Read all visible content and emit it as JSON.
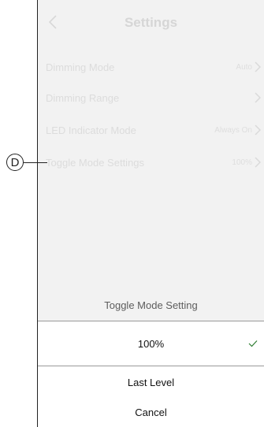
{
  "header": {
    "title": "Settings"
  },
  "settings_rows": [
    {
      "label": "Dimming Mode",
      "value": "Auto"
    },
    {
      "label": "Dimming Range",
      "value": ""
    },
    {
      "label": "LED Indicator Mode",
      "value": "Always On"
    },
    {
      "label": "Toggle Mode Settings",
      "value": "100%"
    }
  ],
  "callout": {
    "letter": "D"
  },
  "sheet": {
    "title": "Toggle Mode Setting",
    "options": [
      {
        "label": "100%",
        "selected": true
      },
      {
        "label": "Last Level",
        "selected": false
      }
    ],
    "cancel_label": "Cancel"
  },
  "colors": {
    "check": "#2e7d32",
    "dim_text": "#dcdcdc"
  }
}
